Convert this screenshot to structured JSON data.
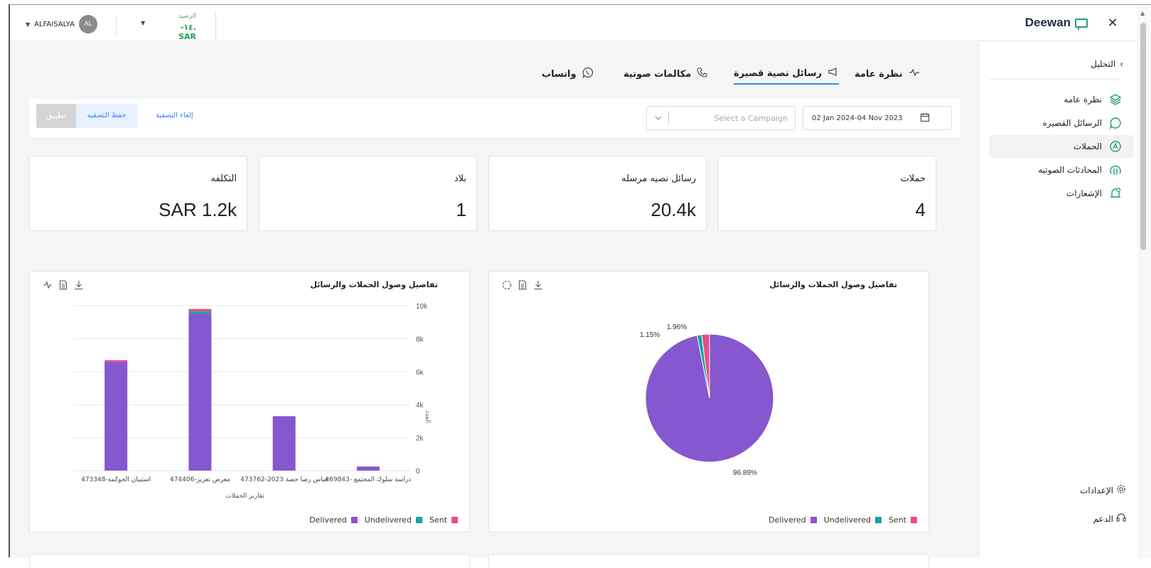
{
  "topbar": {
    "close_icon": "close-icon",
    "logo_text": "Deewan",
    "user_name": "ALFAISALYA",
    "user_initials": "AL",
    "balance_label": "الرصيد",
    "balance_value": "-١٤. SAR"
  },
  "sidebar": {
    "back_label": "التحليل",
    "items": [
      {
        "label": "نظرة عامه",
        "icon": "layers-icon"
      },
      {
        "label": "الرسائل القصيره",
        "icon": "chat-icon"
      },
      {
        "label": "الحملات",
        "icon": "campaign-icon",
        "active": true
      },
      {
        "label": "المحادثات الصوتيه",
        "icon": "voice-icon"
      },
      {
        "label": "الإشعارات",
        "icon": "bell-icon"
      }
    ],
    "settings_label": "الإعدادات",
    "support_label": "الدعم"
  },
  "tabs": [
    {
      "label": "نظرة عامة",
      "icon": "activity-icon"
    },
    {
      "label": "رسائل نصية قصيرة",
      "icon": "megaphone-icon",
      "active": true
    },
    {
      "label": "مكالمات صوتية",
      "icon": "phone-icon"
    },
    {
      "label": "واتساب",
      "icon": "whatsapp-icon"
    }
  ],
  "filters": {
    "date_range": "02 Jan 2024-04 Nov 2023",
    "campaign_placeholder": "Select a Campaign",
    "clear_label": "إلغاء التصفية",
    "save_label": "حفظ التصفيه",
    "apply_label": "تطبيق"
  },
  "stats": [
    {
      "title": "حملات",
      "value": "4"
    },
    {
      "title": "رسائل نصيه مرسله",
      "value": "20.4k"
    },
    {
      "title": "بلاد",
      "value": "1"
    },
    {
      "title": "التكلفه",
      "value": "SAR 1.2k"
    }
  ],
  "colors": {
    "delivered": "#8657cf",
    "undelivered": "#12a4a4",
    "sent": "#e74c89",
    "accent": "#3b82f6"
  },
  "chart_data": [
    {
      "type": "pie",
      "title": "تفاصيل وصول الحملات والرسائل",
      "slices": [
        {
          "name": "Delivered",
          "value": 96.89,
          "label": "96.89%"
        },
        {
          "name": "Undelivered",
          "value": 1.15,
          "label": "1.15%"
        },
        {
          "name": "Sent",
          "value": 1.96,
          "label": "1.96%"
        }
      ],
      "legend": [
        "Delivered",
        "Undelivered",
        "Sent"
      ],
      "legend_position": "bottom-right"
    },
    {
      "type": "bar",
      "title": "تفاصيل وصول الحملات والرسائل",
      "categories": [
        "دراسة سلوك المجتمع -469843",
        "قياس رضا حصة 2023-473762",
        "معرض تعزيز-474406",
        "استبيان الحوكمة-473348"
      ],
      "series": [
        {
          "name": "Delivered",
          "values": [
            250,
            3300,
            9500,
            6600
          ]
        },
        {
          "name": "Undelivered",
          "values": [
            0,
            0,
            150,
            0
          ]
        },
        {
          "name": "Sent",
          "values": [
            0,
            0,
            150,
            100
          ]
        }
      ],
      "xlabel": "تقارير الحملات",
      "ylabel": "العدد",
      "yticks": [
        "0",
        "2k",
        "4k",
        "6k",
        "8k",
        "10k"
      ],
      "ylim": [
        0,
        10000
      ],
      "grid": true,
      "legend_position": "bottom-right"
    }
  ]
}
